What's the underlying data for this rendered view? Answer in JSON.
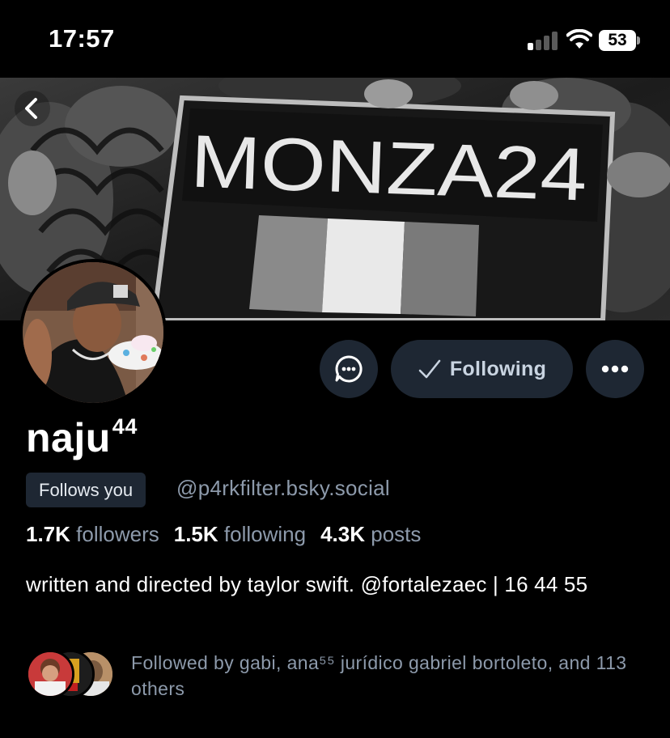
{
  "status_bar": {
    "time": "17:57",
    "battery": "53"
  },
  "banner": {
    "sign_text": "MONZA24"
  },
  "profile": {
    "display_name": "naju",
    "display_name_suffix": "44",
    "follows_you_label": "Follows you",
    "handle": "@p4rkfilter.bsky.social"
  },
  "actions": {
    "following_label": "Following"
  },
  "stats": [
    {
      "count": "1.7K",
      "label": "followers"
    },
    {
      "count": "1.5K",
      "label": "following"
    },
    {
      "count": "4.3K",
      "label": "posts"
    }
  ],
  "bio": "written and directed by taylor swift. @fortalezaec | 16 44 55",
  "followed_by": {
    "text": "Followed by gabi, ana⁵⁵ jurídico gabriel bortoleto, and 113 others"
  },
  "colors": {
    "background": "#000000",
    "button_bg": "#1e2733",
    "muted_text": "#8d9aab",
    "following_text": "#c9d4e1"
  },
  "icons": [
    "chevron-left-icon",
    "message-icon",
    "checkmark-icon",
    "more-icon",
    "signal-icon",
    "wifi-icon",
    "battery-icon"
  ]
}
